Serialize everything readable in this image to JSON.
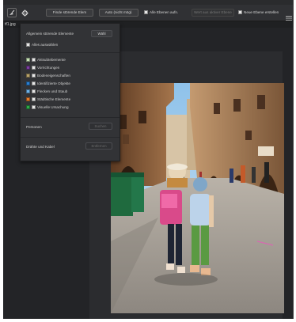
{
  "menu_bar": {
    "items": [
      "",
      "",
      "",
      "",
      "",
      ""
    ]
  },
  "options_bar": {
    "find_distracting_button": "Finde störende Elem",
    "auto_enhance_button": "Auto (nicht mögl.",
    "all_layers_checkbox": "Alle Ebenen aufn.",
    "current_layer_button": "Wert aus aktiver Ebene",
    "new_layer_checkbox": "Neue Ebene erstellen"
  },
  "document": {
    "tab_title": "tf1.jpg"
  },
  "panel": {
    "header": "Allgemein störende Elemente",
    "header_button": "Wähl",
    "select_all": "Alles auswählen",
    "items": [
      {
        "label": "Aktsubtebemente",
        "color": "#c5e0b4"
      },
      {
        "label": "Vorrichtungen",
        "color": "#7b3fa0"
      },
      {
        "label": "Bodeneigenschaften",
        "color": "#b8a36a"
      },
      {
        "label": "Identifizierte Objekte",
        "color": "#2b7fd0"
      },
      {
        "label": "Flecken und Staub",
        "color": "#6fb3e8"
      },
      {
        "label": "Städtische Elemente",
        "color": "#e57a2a"
      },
      {
        "label": "Visuelle Ursachung",
        "color": "#2fa84a"
      }
    ],
    "people_label": "Personen",
    "people_button": "Suchen",
    "cables_label": "Drähte und Kabel",
    "cables_button": "Entfernen"
  },
  "colors": {
    "panel_bg": "#323336",
    "app_bg": "#1f2022",
    "options_bg": "#303134"
  },
  "icons": {
    "tool": "remove-tool-icon",
    "gear": "gear-icon"
  }
}
